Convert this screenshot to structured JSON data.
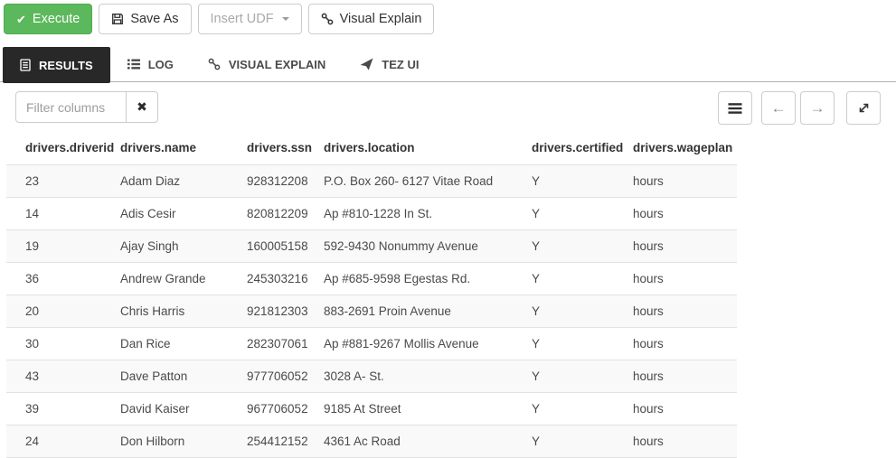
{
  "toolbar": {
    "execute": "Execute",
    "save_as": "Save As",
    "insert_udf": "Insert UDF",
    "visual_explain": "Visual Explain"
  },
  "tabs": [
    {
      "label": "RESULTS",
      "active": true
    },
    {
      "label": "LOG",
      "active": false
    },
    {
      "label": "VISUAL EXPLAIN",
      "active": false
    },
    {
      "label": "TEZ UI",
      "active": false
    }
  ],
  "results": {
    "filter_placeholder": "Filter columns",
    "filter_value": ""
  },
  "icons": {
    "check": "✔",
    "clear": "✖",
    "prev_arrow": "←",
    "next_arrow": "→"
  },
  "colors": {
    "execute_green": "#5cb85c",
    "execute_green_border": "#4cae4c",
    "active_tab_bg": "#282828",
    "row_stripe": "#f9f9f9",
    "row_border": "#e2e2e2",
    "tabbar_border": "#b3b3b3"
  },
  "table": {
    "columns": [
      "drivers.driverid",
      "drivers.name",
      "drivers.ssn",
      "drivers.location",
      "drivers.certified",
      "drivers.wageplan"
    ],
    "rows": [
      [
        "23",
        "Adam Diaz",
        "928312208",
        "P.O. Box 260- 6127 Vitae Road",
        "Y",
        "hours"
      ],
      [
        "14",
        "Adis Cesir",
        "820812209",
        "Ap #810-1228 In St.",
        "Y",
        "hours"
      ],
      [
        "19",
        "Ajay Singh",
        "160005158",
        "592-9430 Nonummy Avenue",
        "Y",
        "hours"
      ],
      [
        "36",
        "Andrew Grande",
        "245303216",
        "Ap #685-9598 Egestas Rd.",
        "Y",
        "hours"
      ],
      [
        "20",
        "Chris Harris",
        "921812303",
        "883-2691 Proin Avenue",
        "Y",
        "hours"
      ],
      [
        "30",
        "Dan Rice",
        "282307061",
        "Ap #881-9267 Mollis Avenue",
        "Y",
        "hours"
      ],
      [
        "43",
        "Dave Patton",
        "977706052",
        "3028 A- St.",
        "Y",
        "hours"
      ],
      [
        "39",
        "David Kaiser",
        "967706052",
        "9185 At Street",
        "Y",
        "hours"
      ],
      [
        "24",
        "Don Hilborn",
        "254412152",
        "4361 Ac Road",
        "Y",
        "hours"
      ]
    ]
  }
}
